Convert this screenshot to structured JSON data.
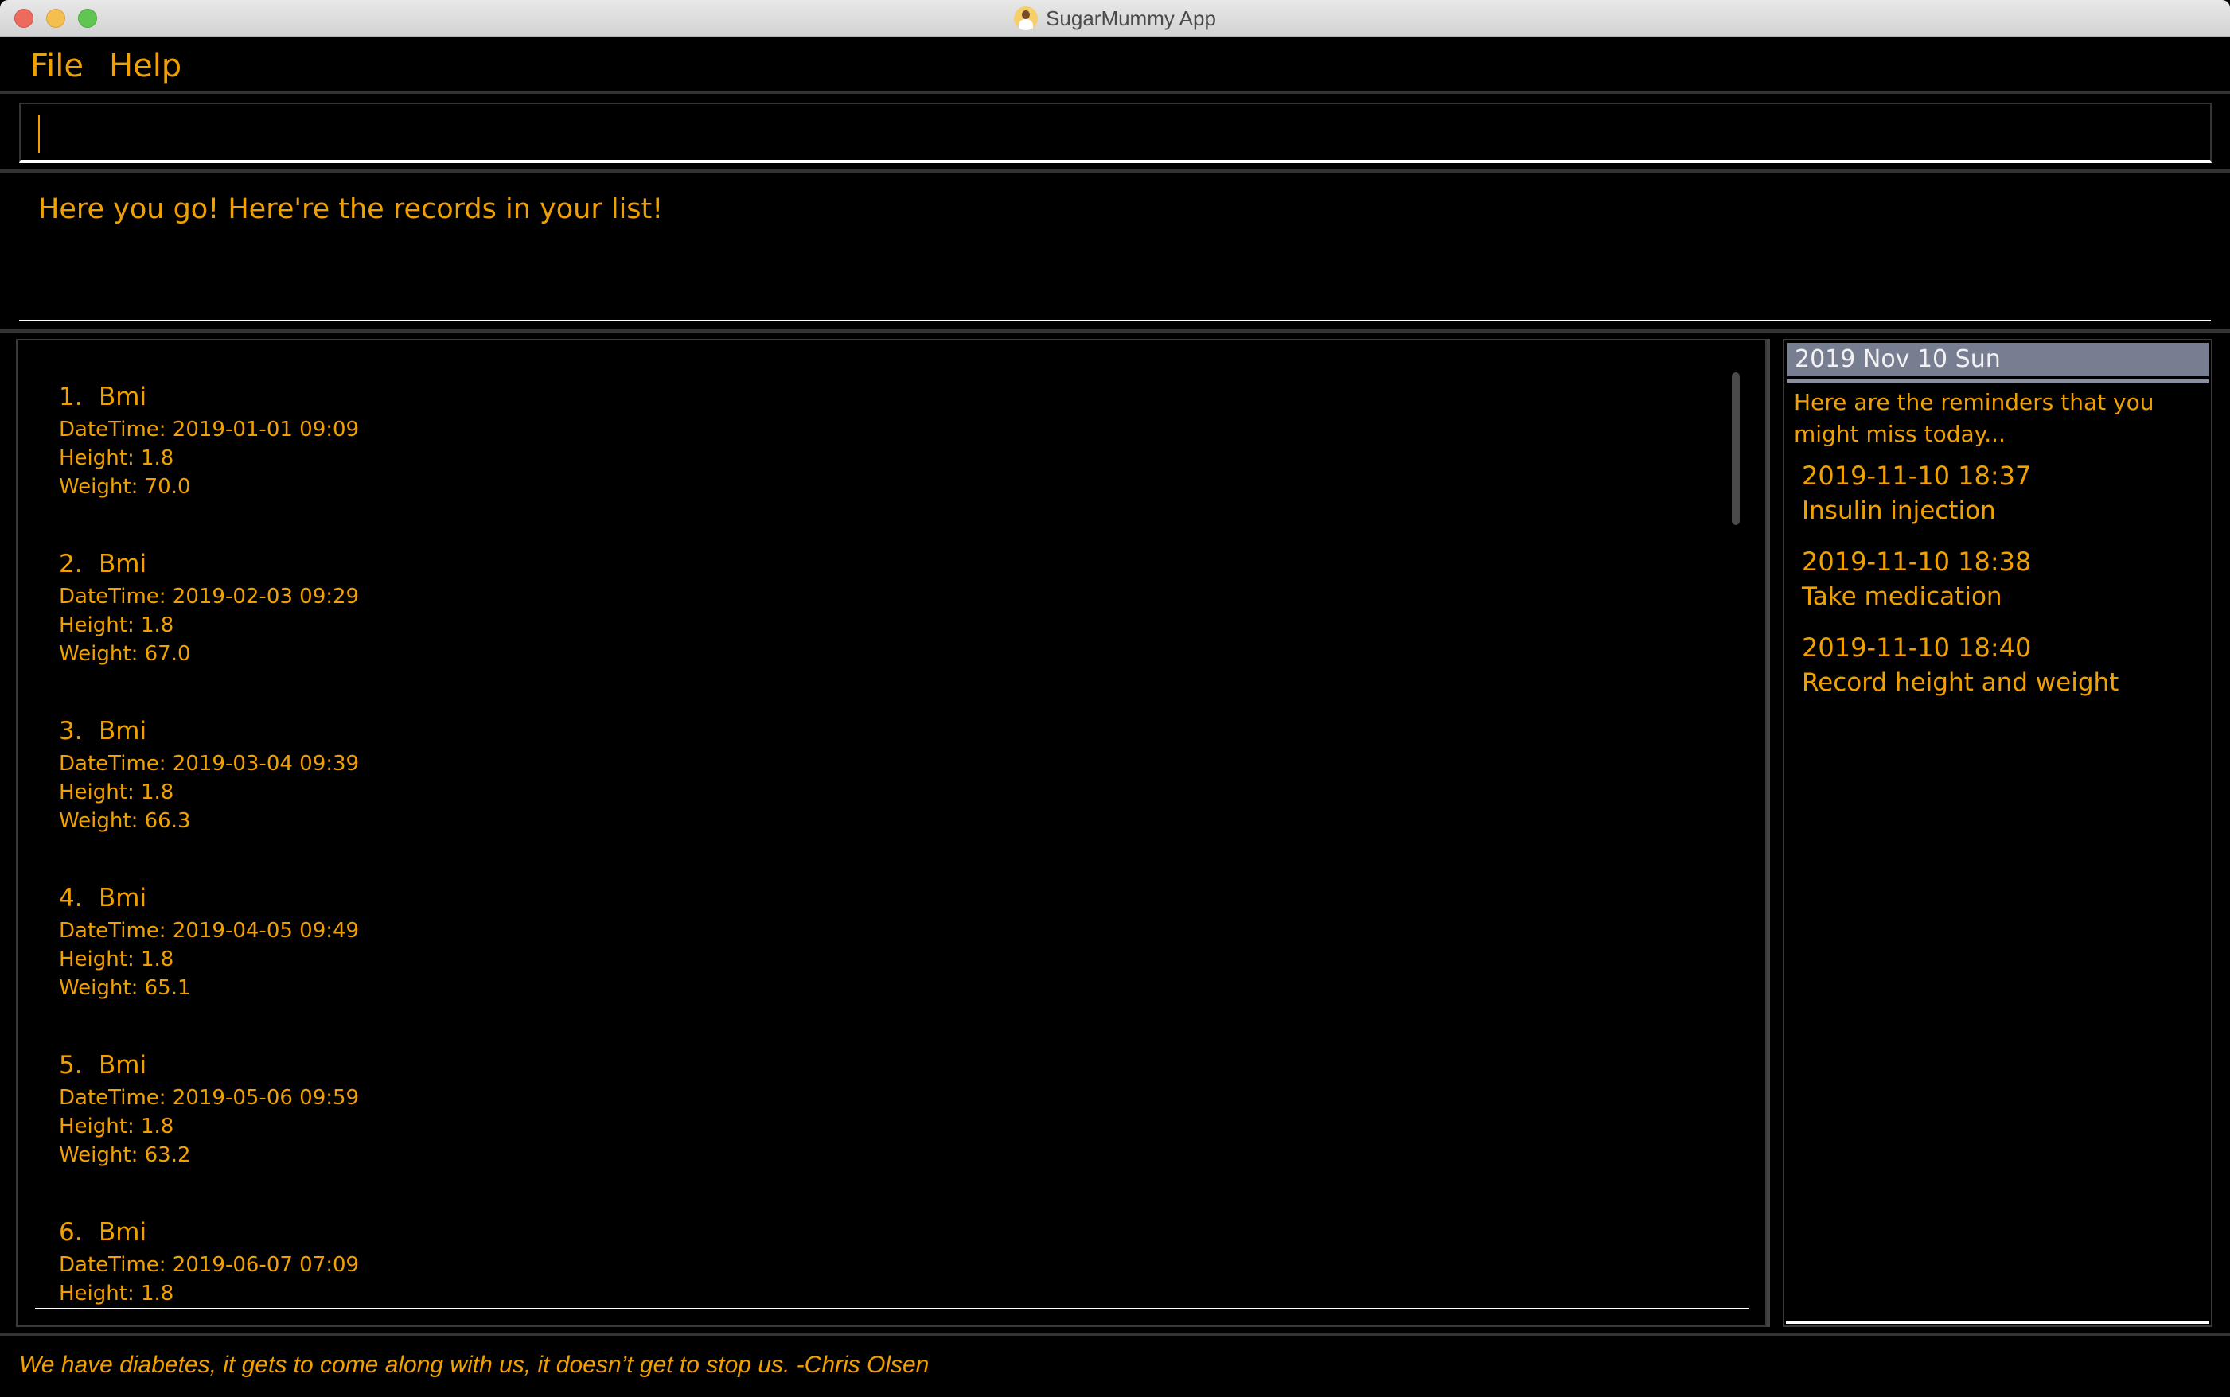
{
  "window": {
    "title": "SugarMummy App",
    "app_icon": "doctor-avatar-icon"
  },
  "menu": {
    "items": [
      {
        "label": "File"
      },
      {
        "label": "Help"
      }
    ]
  },
  "command": {
    "value": "",
    "placeholder": ""
  },
  "result": {
    "message": "Here you go! Here're the records in your list!"
  },
  "records": [
    {
      "index": "1.",
      "type": "Bmi",
      "datetime": "DateTime: 2019-01-01 09:09",
      "height": "Height: 1.8",
      "weight": "Weight: 70.0"
    },
    {
      "index": "2.",
      "type": "Bmi",
      "datetime": "DateTime: 2019-02-03 09:29",
      "height": "Height: 1.8",
      "weight": "Weight: 67.0"
    },
    {
      "index": "3.",
      "type": "Bmi",
      "datetime": "DateTime: 2019-03-04 09:39",
      "height": "Height: 1.8",
      "weight": "Weight: 66.3"
    },
    {
      "index": "4.",
      "type": "Bmi",
      "datetime": "DateTime: 2019-04-05 09:49",
      "height": "Height: 1.8",
      "weight": "Weight: 65.1"
    },
    {
      "index": "5.",
      "type": "Bmi",
      "datetime": "DateTime: 2019-05-06 09:59",
      "height": "Height: 1.8",
      "weight": "Weight: 63.2"
    },
    {
      "index": "6.",
      "type": "Bmi",
      "datetime": "DateTime: 2019-06-07 07:09",
      "height": "Height: 1.8",
      "weight": ""
    }
  ],
  "reminders": {
    "date_header": "2019 Nov 10 Sun",
    "intro": "Here are the reminders that you might miss today...",
    "items": [
      {
        "time": "2019-11-10 18:37",
        "description": "Insulin injection"
      },
      {
        "time": "2019-11-10 18:38",
        "description": "Take medication"
      },
      {
        "time": "2019-11-10 18:40",
        "description": "Record height and weight"
      }
    ]
  },
  "status": {
    "quote": "We have diabetes, it gets to come along with us, it doesn’t get to stop us. -Chris Olsen"
  },
  "colors": {
    "accent": "#f0a000",
    "background": "#000000",
    "date_header_bg": "#787e92"
  }
}
